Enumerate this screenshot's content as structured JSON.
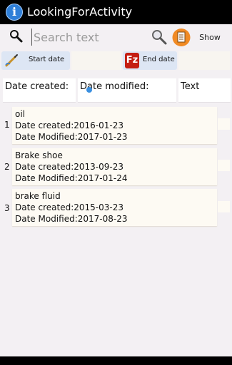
{
  "app": {
    "title": "LookingForActivity"
  },
  "search": {
    "placeholder": "Search text",
    "value": "",
    "show_label": "Show"
  },
  "date_filter": {
    "start_label": "Start date",
    "end_label": "End date"
  },
  "columns": {
    "created": "Date created:",
    "modified": "Date modified:",
    "text": "Text"
  },
  "rows": [
    {
      "num": "1",
      "title": "oil",
      "created": "Date created:2016-01-23",
      "modified": "Date Modified:2017-01-23"
    },
    {
      "num": "2",
      "title": "Brake shoe",
      "created": "Date created:2013-09-23",
      "modified": "Date Modified:2017-01-24"
    },
    {
      "num": "3",
      "title": "brake fluid",
      "created": "Date created:2015-03-23",
      "modified": "Date Modified:2017-08-23"
    }
  ],
  "colors": {
    "titlebar": "#000000",
    "background": "#f3f0f3",
    "button": "#dde6f4",
    "card": "#fdfaf3",
    "accent": "#3a8fe0"
  },
  "icons": {
    "app": "info-icon",
    "search": "search-icon",
    "zoom": "zoom-icon",
    "doc": "document-icon",
    "start": "pen-icon",
    "end": "filezilla-icon"
  }
}
